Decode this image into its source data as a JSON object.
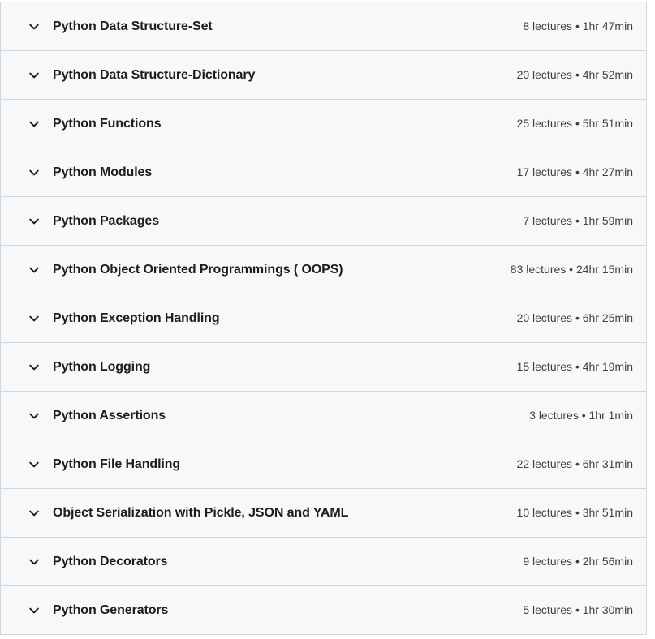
{
  "theme": {
    "row_background": "#f7f8fa",
    "border_color": "#d1d7dc",
    "title_color": "#1c1d1f",
    "meta_color": "#3e4143",
    "page_background": "#ffffff"
  },
  "curriculum": {
    "chevron_icon": "chevron-down-icon",
    "meta_separator": "•",
    "sections": [
      {
        "title": "Python Data Structure-Set",
        "lectures": "8 lectures",
        "duration": "1hr 47min",
        "meta": "8 lectures • 1hr 47min",
        "expanded": false
      },
      {
        "title": "Python Data Structure-Dictionary",
        "lectures": "20 lectures",
        "duration": "4hr 52min",
        "meta": "20 lectures • 4hr 52min",
        "expanded": false
      },
      {
        "title": "Python Functions",
        "lectures": "25 lectures",
        "duration": "5hr 51min",
        "meta": "25 lectures • 5hr 51min",
        "expanded": false
      },
      {
        "title": "Python Modules",
        "lectures": "17 lectures",
        "duration": "4hr 27min",
        "meta": "17 lectures • 4hr 27min",
        "expanded": false
      },
      {
        "title": "Python Packages",
        "lectures": "7 lectures",
        "duration": "1hr 59min",
        "meta": "7 lectures • 1hr 59min",
        "expanded": false
      },
      {
        "title": "Python Object Oriented Programmings ( OOPS)",
        "lectures": "83 lectures",
        "duration": "24hr 15min",
        "meta": "83 lectures • 24hr 15min",
        "expanded": false
      },
      {
        "title": "Python Exception Handling",
        "lectures": "20 lectures",
        "duration": "6hr 25min",
        "meta": "20 lectures • 6hr 25min",
        "expanded": false
      },
      {
        "title": "Python Logging",
        "lectures": "15 lectures",
        "duration": "4hr 19min",
        "meta": "15 lectures • 4hr 19min",
        "expanded": false
      },
      {
        "title": "Python Assertions",
        "lectures": "3 lectures",
        "duration": "1hr 1min",
        "meta": "3 lectures • 1hr 1min",
        "expanded": false
      },
      {
        "title": "Python File Handling",
        "lectures": "22 lectures",
        "duration": "6hr 31min",
        "meta": "22 lectures • 6hr 31min",
        "expanded": false
      },
      {
        "title": "Object Serialization with Pickle, JSON and YAML",
        "lectures": "10 lectures",
        "duration": "3hr 51min",
        "meta": "10 lectures • 3hr 51min",
        "expanded": false
      },
      {
        "title": "Python Decorators",
        "lectures": "9 lectures",
        "duration": "2hr 56min",
        "meta": "9 lectures • 2hr 56min",
        "expanded": false
      },
      {
        "title": "Python Generators",
        "lectures": "5 lectures",
        "duration": "1hr 30min",
        "meta": "5 lectures • 1hr 30min",
        "expanded": false
      }
    ]
  }
}
